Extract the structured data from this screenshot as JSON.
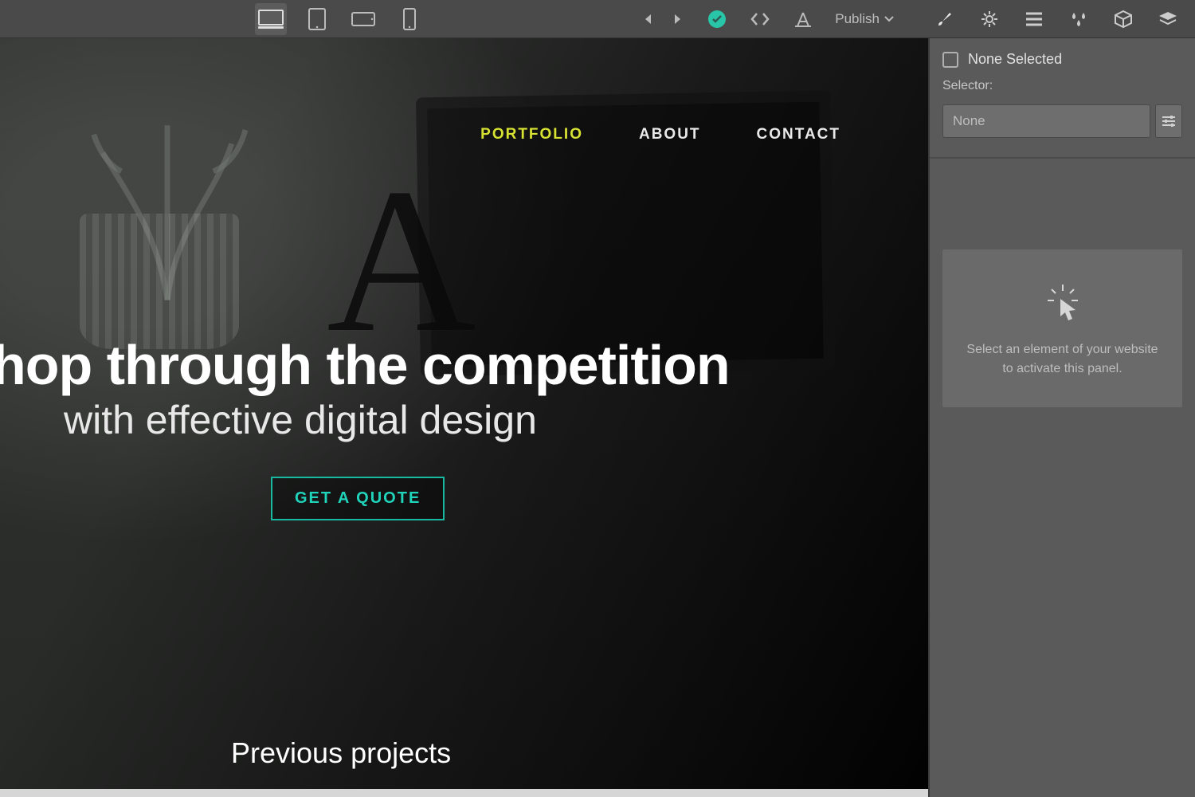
{
  "toolbar": {
    "publish_label": "Publish"
  },
  "canvas": {
    "nav": {
      "portfolio": "PORTFOLIO",
      "about": "ABOUT",
      "contact": "CONTACT"
    },
    "headline": "hop through the competition",
    "subhead": "with effective digital design",
    "cta_label": "GET A QUOTE",
    "decorative_letter": "A",
    "section_title": "Previous projects"
  },
  "side_panel": {
    "none_selected": "None Selected",
    "selector_label": "Selector:",
    "selector_value": "None",
    "placeholder_line1": "Select an element of your website",
    "placeholder_line2": "to activate this panel."
  }
}
